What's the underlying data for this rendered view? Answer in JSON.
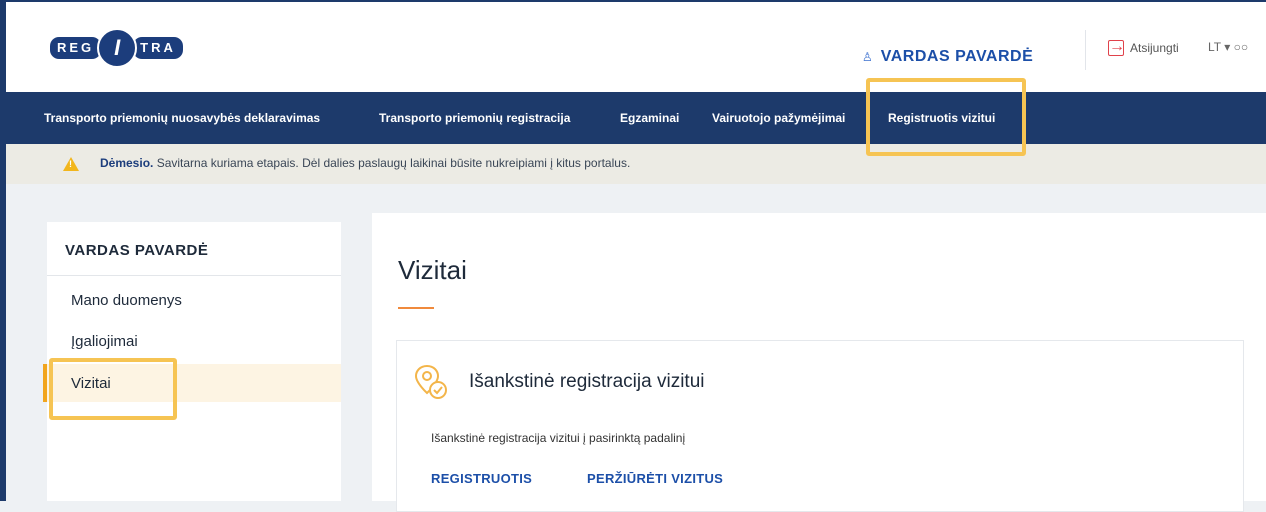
{
  "header": {
    "logo_text_left": "REG",
    "logo_text_mid": "I",
    "logo_text_right": "TRA",
    "user_name": "VARDAS PAVARDĖ",
    "logout_label": "Atsijungti",
    "language": "LT ▾ ○○"
  },
  "nav": {
    "items": [
      {
        "label": "Transporto priemonių nuosavybės deklaravimas"
      },
      {
        "label": "Transporto priemonių registracija"
      },
      {
        "label": "Egzaminai"
      },
      {
        "label": "Vairuotojo pažymėjimai"
      },
      {
        "label": "Registruotis vizitui"
      }
    ]
  },
  "notice": {
    "bold": "Dėmesio.",
    "text": " Savitarna kuriama etapais. Dėl dalies paslaugų laikinai būsite nukreipiami į kitus portalus."
  },
  "sidebar": {
    "title": "VARDAS PAVARDĖ",
    "items": [
      {
        "label": "Mano duomenys"
      },
      {
        "label": "Įgaliojimai"
      },
      {
        "label": "Vizitai"
      }
    ],
    "active": "Vizitai"
  },
  "main": {
    "title": "Vizitai",
    "card": {
      "title": "Išankstinė registracija vizitui",
      "description": "Išankstinė registracija vizitui į pasirinktą padalinį",
      "register_label": "REGISTRUOTIS",
      "view_label": "PERŽIŪRĖTI VIZITUS"
    }
  },
  "colors": {
    "nav_bg": "#1d3a6b",
    "accent_orange": "#f08a3c",
    "highlight": "#f6c453",
    "link_blue": "#1c4fa8",
    "warning": "#f2b61c"
  }
}
